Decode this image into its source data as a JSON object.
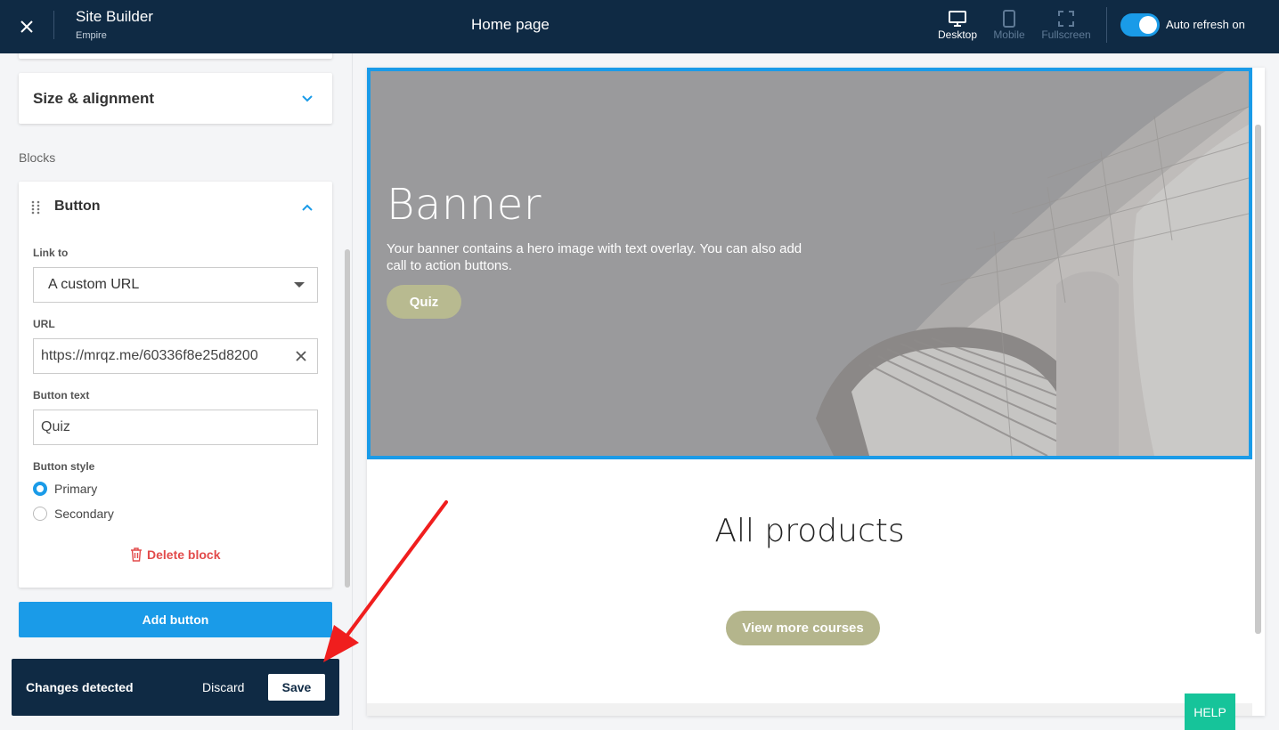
{
  "topbar": {
    "app_title": "Site Builder",
    "app_subtitle": "Empire",
    "page_title": "Home page",
    "views": [
      {
        "label": "Desktop",
        "icon": "desktop-icon",
        "active": true
      },
      {
        "label": "Mobile",
        "icon": "mobile-icon",
        "active": false
      },
      {
        "label": "Fullscreen",
        "icon": "fullscreen-icon",
        "active": false
      }
    ],
    "auto_refresh_label": "Auto refresh on",
    "auto_refresh_on": true
  },
  "sidebar": {
    "size_alignment_title": "Size & alignment",
    "blocks_label": "Blocks",
    "block": {
      "title": "Button",
      "link_to_label": "Link to",
      "link_to_value": "A custom URL",
      "url_label": "URL",
      "url_value": "https://mrqz.me/60336f8e25d8200",
      "button_text_label": "Button text",
      "button_text_value": "Quiz",
      "button_style_label": "Button style",
      "style_options": [
        "Primary",
        "Secondary"
      ],
      "style_selected": "Primary",
      "delete_label": "Delete block"
    },
    "add_button_label": "Add button"
  },
  "changes_bar": {
    "message": "Changes detected",
    "discard_label": "Discard",
    "save_label": "Save"
  },
  "preview": {
    "banner_heading": "Banner",
    "banner_text": "Your banner contains a hero image with text overlay. You can also add call to action buttons.",
    "banner_button": "Quiz",
    "section_heading": "All products",
    "more_button": "View more courses"
  },
  "help_label": "HELP",
  "colors": {
    "topbar_bg": "#0f2a44",
    "accent": "#1a9be8",
    "danger": "#e24b4b",
    "button_olive": "#b8ba90",
    "help_green": "#16c49a"
  }
}
